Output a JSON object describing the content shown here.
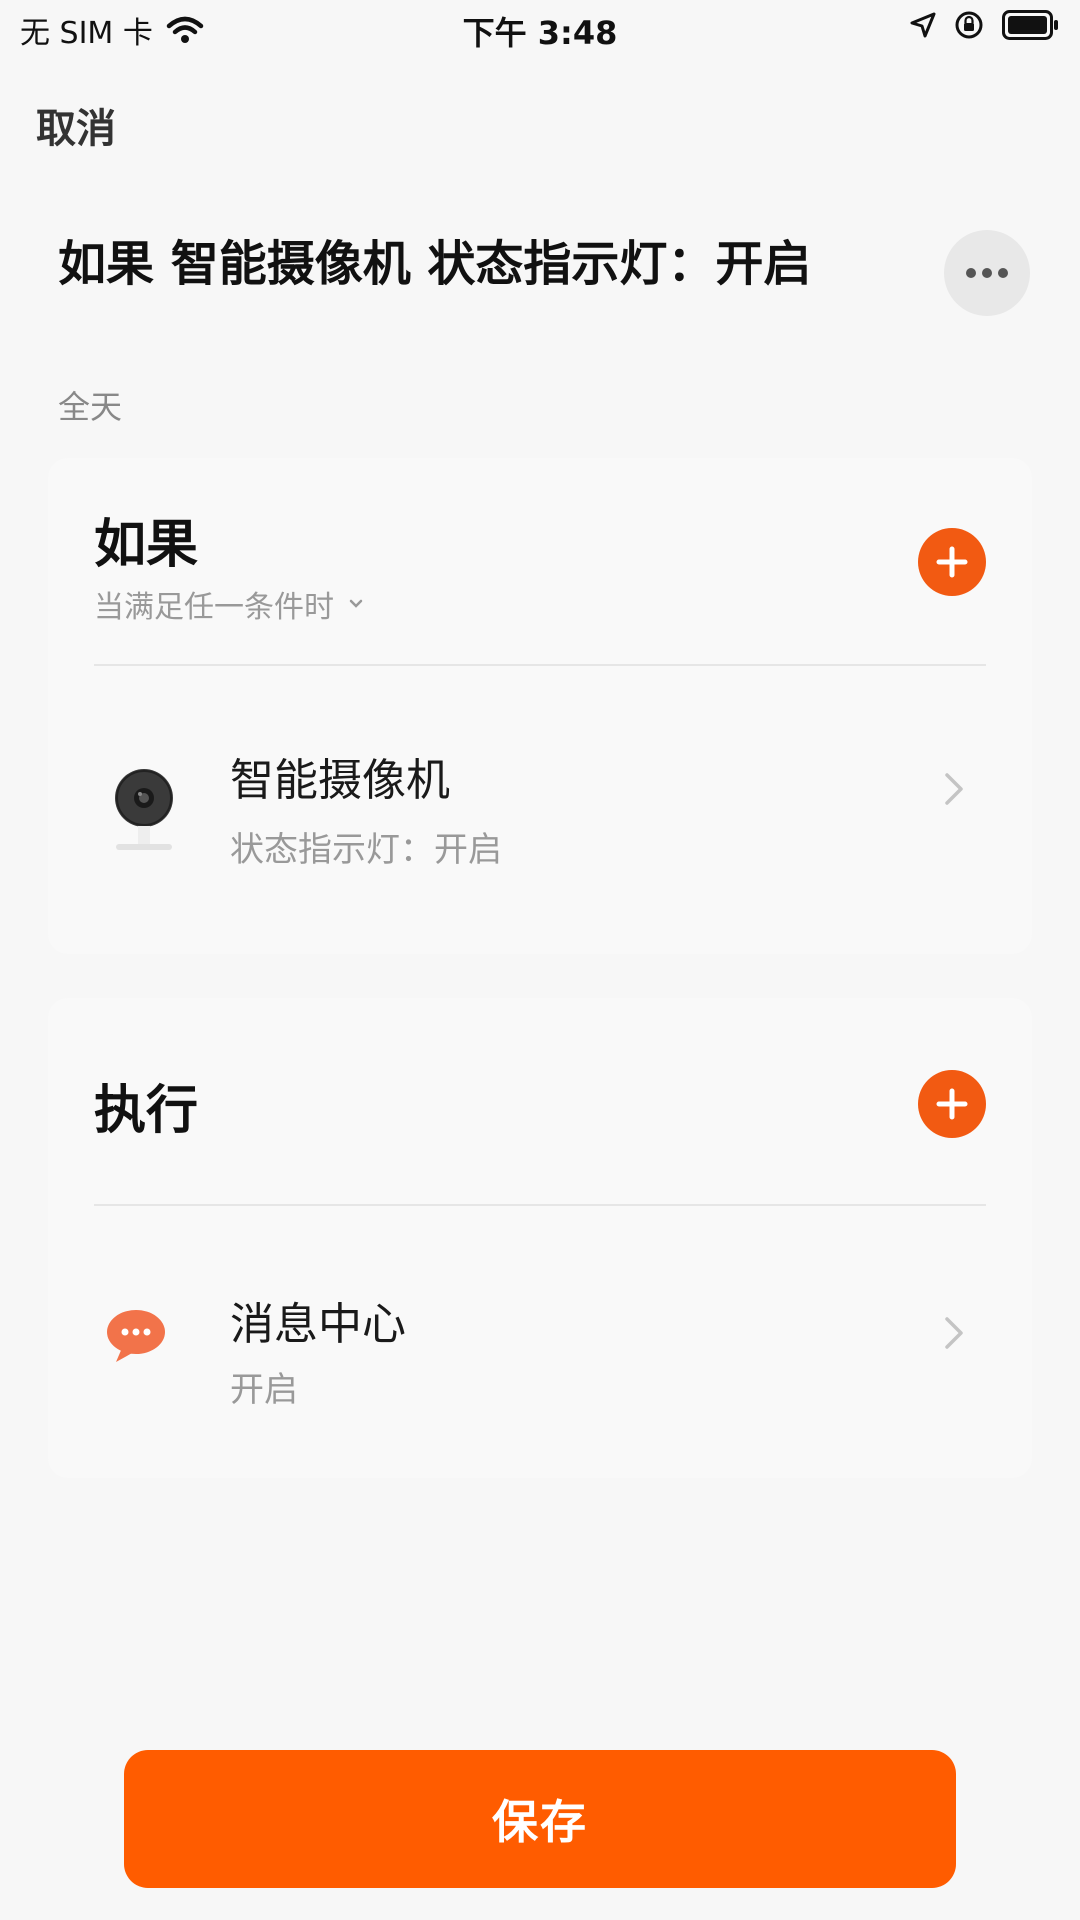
{
  "status_bar": {
    "carrier": "无 SIM 卡",
    "time": "下午 3:48"
  },
  "nav": {
    "cancel_label": "取消"
  },
  "header": {
    "title": "如果 智能摄像机 状态指示灯：开启",
    "subtitle": "全天",
    "more_icon": "more-dots-icon"
  },
  "if_section": {
    "title": "如果",
    "condition_mode": "当满足任一条件时",
    "add_icon": "plus-icon",
    "items": [
      {
        "icon": "camera-icon",
        "name": "智能摄像机",
        "detail": "状态指示灯：开启"
      }
    ]
  },
  "do_section": {
    "title": "执行",
    "add_icon": "plus-icon",
    "items": [
      {
        "icon": "message-bubble-icon",
        "name": "消息中心",
        "detail": "开启"
      }
    ]
  },
  "footer": {
    "save_label": "保存"
  },
  "colors": {
    "accent": "#f25a12",
    "save_button": "#ff5c00",
    "background": "#f7f7f7",
    "secondary_text": "#999999"
  }
}
